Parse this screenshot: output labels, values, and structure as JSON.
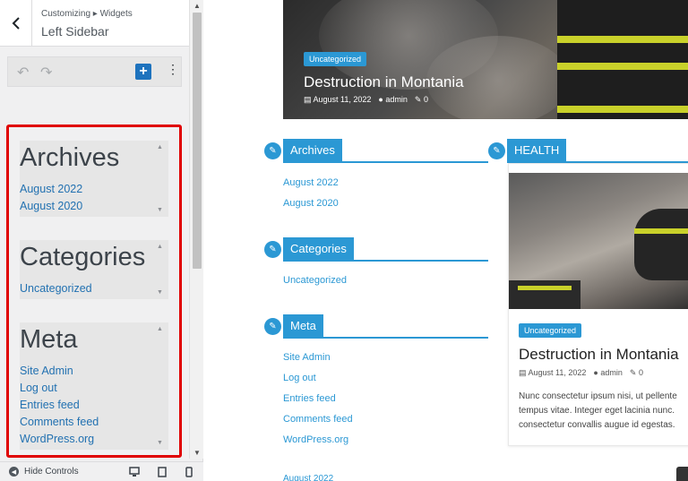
{
  "customizer": {
    "breadcrumb": "Customizing ▸ Widgets",
    "title": "Left Sidebar",
    "footer": {
      "hide_controls": "Hide Controls"
    },
    "widgets": [
      {
        "title": "Archives",
        "links": [
          "August 2022",
          "August 2020"
        ]
      },
      {
        "title": "Categories",
        "links": [
          "Uncategorized"
        ]
      },
      {
        "title": "Meta",
        "links": [
          "Site Admin",
          "Log out",
          "Entries feed",
          "Comments feed",
          "WordPress.org"
        ]
      }
    ]
  },
  "preview": {
    "hero": {
      "tag": "Uncategorized",
      "title": "Destruction in Montania",
      "date": "August 11, 2022",
      "author": "admin",
      "comments": "0"
    },
    "sidebar": {
      "archives": {
        "heading": "Archives",
        "links": [
          "August 2022",
          "August 2020"
        ]
      },
      "categories": {
        "heading": "Categories",
        "links": [
          "Uncategorized"
        ]
      },
      "meta": {
        "heading": "Meta",
        "links": [
          "Site Admin",
          "Log out",
          "Entries feed",
          "Comments feed",
          "WordPress.org"
        ]
      },
      "bottom_date": "August 2022"
    },
    "health": {
      "heading": "HEALTH",
      "tag": "Uncategorized",
      "title": "Destruction in Montania",
      "date": "August 11, 2022",
      "author": "admin",
      "comments": "0",
      "excerpt": [
        "Nunc consectetur ipsum nisi, ut pellente",
        "tempus vitae. Integer eget lacinia nunc.",
        "consectetur convallis augue id egestas."
      ]
    }
  },
  "colors": {
    "accent": "#2b98d4",
    "wp_blue": "#2271b1",
    "highlight": "#e00000"
  }
}
